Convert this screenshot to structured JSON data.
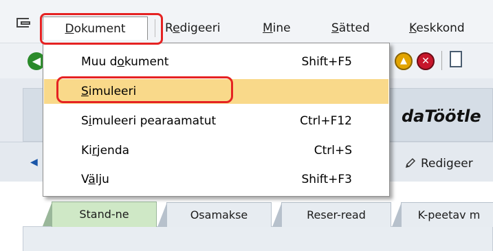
{
  "menubar": {
    "items": [
      {
        "label": "Dokument",
        "mnemonic": 0
      },
      {
        "label": "Redigeeri",
        "mnemonic": 1
      },
      {
        "label": "Mine",
        "mnemonic": 0
      },
      {
        "label": "Sätted",
        "mnemonic": 0
      },
      {
        "label": "Keskkond",
        "mnemonic": 0
      }
    ],
    "app_icon": "menu-window-icon"
  },
  "toolbar": {
    "icons": [
      "green-back-icon",
      "yellow-exit-icon",
      "red-cancel-icon",
      "print-icon"
    ]
  },
  "window": {
    "title": "daTöötle"
  },
  "app_toolbar": {
    "edit_label": "Redigeer",
    "edit_icon": "pencil-icon"
  },
  "dropdown": {
    "items": [
      {
        "label": "Muu dokument",
        "mnemonic": 5,
        "shortcut": "Shift+F5"
      },
      {
        "label": "Simuleeri",
        "mnemonic": 0,
        "shortcut": ""
      },
      {
        "label": "Simuleeri pearaamatut",
        "mnemonic": 1,
        "shortcut": "Ctrl+F12"
      },
      {
        "label": "Kirjenda",
        "mnemonic": 2,
        "shortcut": "Ctrl+S"
      },
      {
        "label": "Välju",
        "mnemonic": 1,
        "shortcut": "Shift+F3"
      }
    ],
    "selected_index": 1
  },
  "tabs": [
    {
      "label": "Stand-ne",
      "active": true
    },
    {
      "label": "Osamakse",
      "active": false
    },
    {
      "label": "Reser-read",
      "active": false
    },
    {
      "label": "K-peetav m",
      "active": false
    }
  ],
  "colors": {
    "highlight_red": "#e52222",
    "menu_selected": "#f9d98a",
    "active_tab": "#cfe8c6"
  }
}
